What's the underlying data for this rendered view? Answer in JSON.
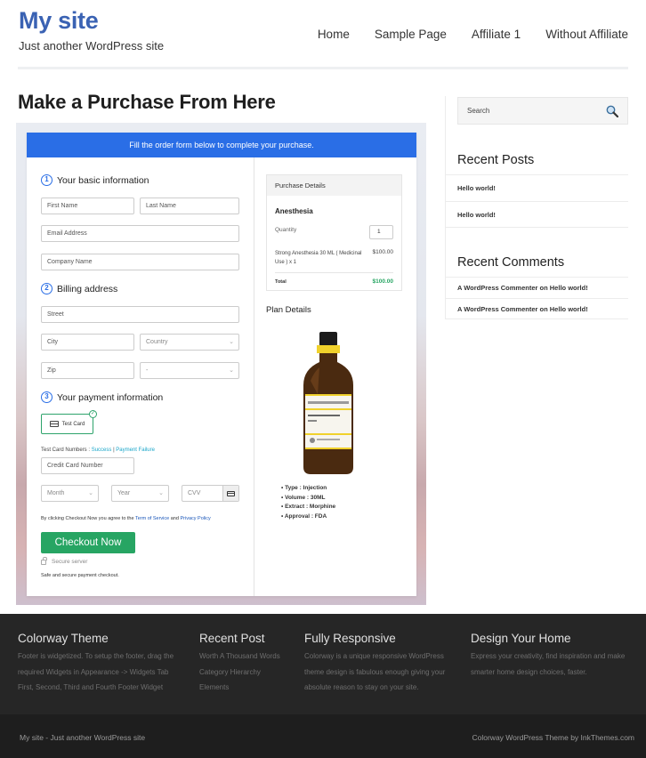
{
  "site": {
    "title": "My site",
    "tagline": "Just another WordPress site"
  },
  "nav": {
    "items": [
      "Home",
      "Sample Page",
      "Affiliate 1",
      "Without Affiliate"
    ]
  },
  "page": {
    "title": "Make a Purchase From Here"
  },
  "checkout": {
    "banner": "Fill the order form below to complete your purchase.",
    "colors": {
      "banner": "#2a6ee6",
      "button": "#27a563",
      "total": "#27a563",
      "test_card_border": "#2ea36b"
    },
    "steps": [
      {
        "num": "1",
        "label": "Your basic information"
      },
      {
        "num": "2",
        "label": "Billing address"
      },
      {
        "num": "3",
        "label": "Your payment information"
      }
    ],
    "fields": {
      "first_name": "First Name",
      "last_name": "Last Name",
      "email": "Email Address",
      "company": "Company Name",
      "street": "Street",
      "city": "City",
      "country": "Country",
      "zip": "Zip",
      "state": "-",
      "card_number": "Credit Card Number",
      "month": "Month",
      "year": "Year",
      "cvv": "CVV"
    },
    "test_card": {
      "label": "Test Card",
      "numbers_label": "Test Card Numbers :",
      "success": "Success",
      "separator": "|",
      "failure": "Payment Failure"
    },
    "agree": {
      "prefix": "By clicking Checkout Now you agree to the",
      "terms": "Term of Service",
      "and": "and",
      "privacy": "Privacy Policy"
    },
    "button": "Checkout Now",
    "secure": "Secure server",
    "safe": "Safe and secure payment checkout."
  },
  "purchase": {
    "header": "Purchase Details",
    "product": "Anesthesia",
    "quantity_label": "Quantity",
    "quantity": "1",
    "line_item": "Strong Anesthesia 30 ML ( Medicinal Use ) x 1",
    "line_price": "$100.00",
    "total_label": "Total",
    "total": "$100.00"
  },
  "plan": {
    "title": "Plan Details",
    "details": [
      "Type : Injection",
      "Volume : 30ML",
      "Extract : Morphine",
      "Approval : FDA"
    ]
  },
  "sidebar": {
    "search_placeholder": "Search",
    "recent_posts_title": "Recent Posts",
    "recent_posts": [
      "Hello world!",
      "Hello world!"
    ],
    "recent_comments_title": "Recent Comments",
    "recent_comments": [
      "A WordPress Commenter on Hello world!",
      "A WordPress Commenter on Hello world!"
    ]
  },
  "footer": {
    "columns": [
      {
        "title": "Colorway Theme",
        "lines": [
          "Footer is widgetized. To setup the footer, drag the",
          "required Widgets in Appearance -> Widgets Tab",
          "First, Second, Third and Fourth Footer Widget"
        ]
      },
      {
        "title": "Recent Post",
        "lines": [
          "Worth A Thousand Words",
          "Category Hierarchy",
          "Elements"
        ]
      },
      {
        "title": "Fully Responsive",
        "lines": [
          "Colorway is a unique responsive WordPress",
          "theme design is fabulous enough giving your",
          "absolute reason to stay on your site."
        ]
      },
      {
        "title": "Design Your Home",
        "lines": [
          "Express your creativity, find inspiration and make",
          "smarter home design choices, faster."
        ]
      }
    ],
    "bottom_left": "My site - Just another WordPress site",
    "bottom_right": "Colorway WordPress Theme by InkThemes.com"
  }
}
